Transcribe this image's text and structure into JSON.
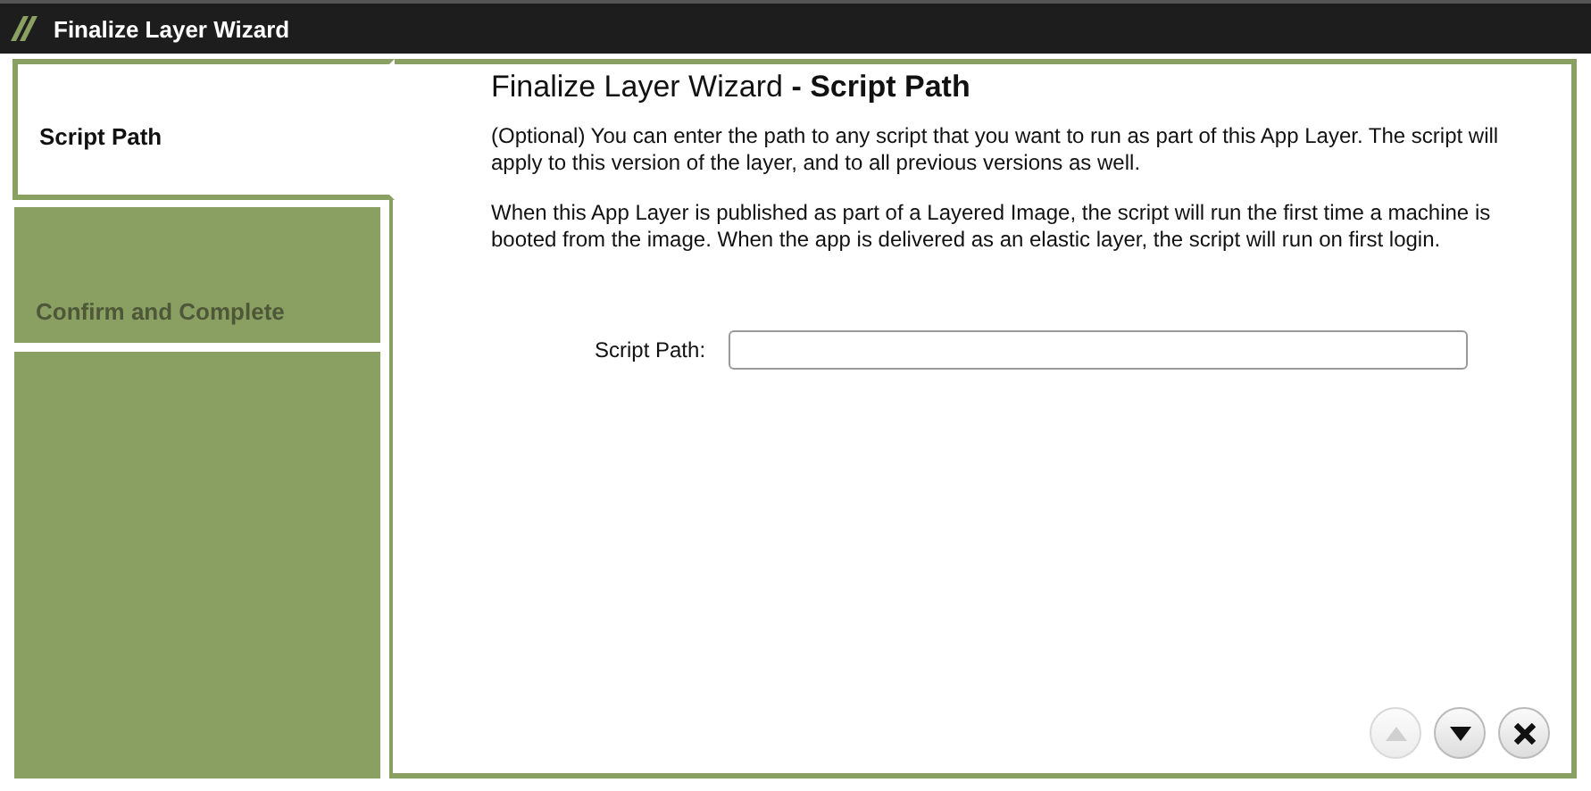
{
  "window": {
    "title": "Finalize Layer Wizard"
  },
  "steps": [
    {
      "label": "Script Path",
      "selected": true,
      "disabled": false
    },
    {
      "label": "Confirm and Complete",
      "selected": false,
      "disabled": true
    }
  ],
  "heading": {
    "title": "Finalize Layer Wizard",
    "separator": "-",
    "subtitle": "Script Path"
  },
  "paragraphs": [
    "(Optional) You can enter the path to any script that you want to run as part of this App Layer. The script will apply to this version of the layer, and to all previous versions as well.",
    "When this App Layer is published as part of a Layered Image, the script will run the first time a machine is booted from the image. When the app is delivered as an elastic layer, the script will run on first login."
  ],
  "script_path": {
    "label": "Script Path:"
  },
  "buttons": [
    {
      "kind": "up",
      "disabled": true
    },
    {
      "kind": "down",
      "disabled": false
    },
    {
      "kind": "close",
      "disabled": false
    }
  ]
}
